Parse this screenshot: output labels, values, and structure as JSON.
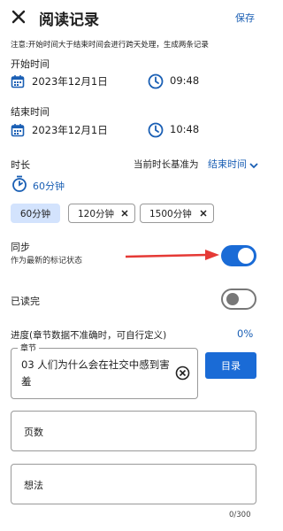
{
  "header": {
    "title": "阅读记录",
    "save_label": "保存"
  },
  "note": "注意:开始时间大于结束时间会进行跨天处理，生成两条记录",
  "start": {
    "label": "开始时间",
    "date": "2023年12月1日",
    "time": "09:48"
  },
  "end": {
    "label": "结束时间",
    "date": "2023年12月1日",
    "time": "10:48"
  },
  "duration": {
    "label": "时长",
    "basis_label": "当前时长基准为",
    "basis_value": "结束时间",
    "value": "60分钟",
    "chips": [
      {
        "label": "60分钟",
        "selected": true
      },
      {
        "label": "120分钟",
        "selected": false
      },
      {
        "label": "1500分钟",
        "selected": false
      }
    ]
  },
  "sync": {
    "label": "同步",
    "sublabel": "作为最新的标记状态",
    "on": true
  },
  "finished": {
    "label": "已读完",
    "on": false
  },
  "progress": {
    "label": "进度(章节数据不准确时，可自行定义)",
    "percent": "0%"
  },
  "chapter": {
    "field_label": "章节",
    "value": "03 人们为什么会在社交中感到害羞",
    "button": "目录"
  },
  "pages": {
    "placeholder": "页数"
  },
  "thoughts": {
    "placeholder": "想法",
    "counter": "0/300"
  },
  "colors": {
    "accent": "#1a6bd6",
    "arrow": "#e53935",
    "chip_selected": "#d3e3fd"
  }
}
